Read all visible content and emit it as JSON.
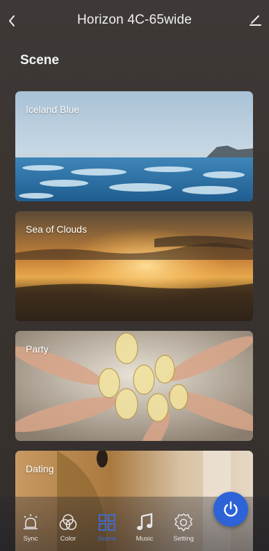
{
  "header": {
    "title": "Horizon 4C-65wide"
  },
  "section_title": "Scene",
  "scenes": [
    {
      "label": "Iceland Blue"
    },
    {
      "label": "Sea of Clouds"
    },
    {
      "label": "Party"
    },
    {
      "label": "Dating"
    }
  ],
  "tabs": [
    {
      "label": "Sync",
      "icon": "sync-icon"
    },
    {
      "label": "Color",
      "icon": "color-icon"
    },
    {
      "label": "Scene",
      "icon": "scene-icon",
      "active": true
    },
    {
      "label": "Music",
      "icon": "music-icon"
    },
    {
      "label": "Setting",
      "icon": "setting-icon"
    }
  ],
  "colors": {
    "accent": "#2d63d6",
    "active_tab": "#3b6fe0",
    "background": "#3a3431"
  }
}
